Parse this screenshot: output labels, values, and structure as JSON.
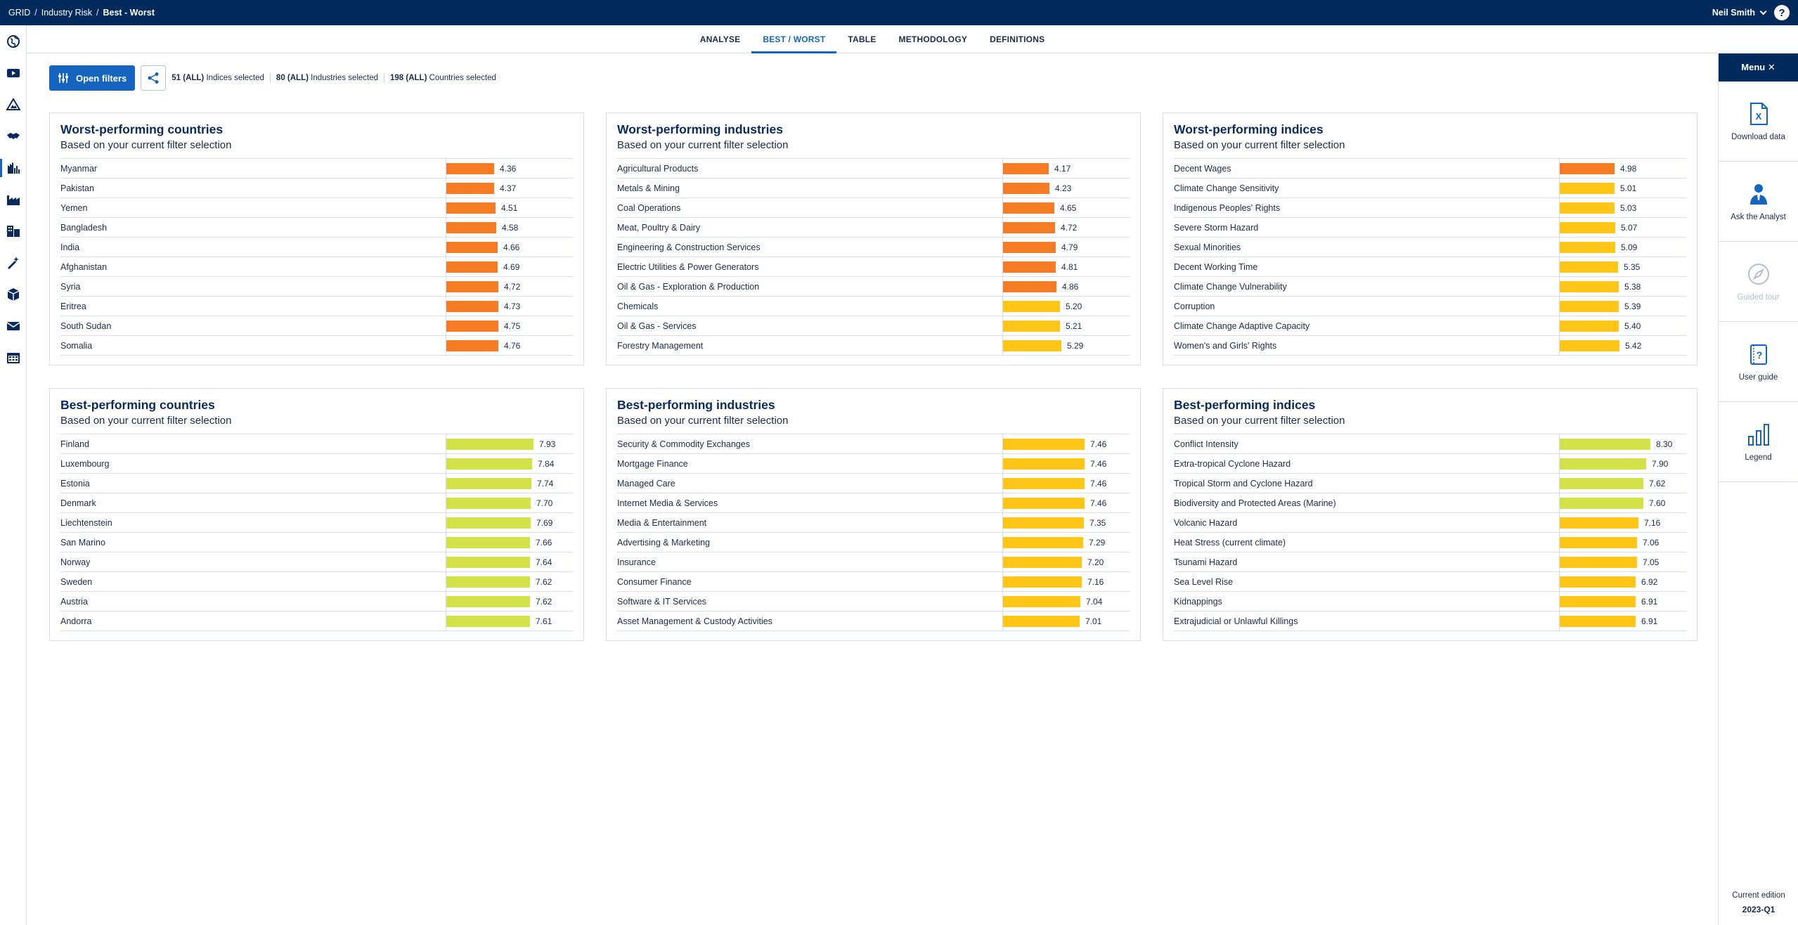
{
  "topbar": {
    "crumbs": [
      "GRID",
      "Industry Risk",
      "Best - Worst"
    ],
    "user": "Neil Smith",
    "help": "?"
  },
  "tabs": [
    "ANALYSE",
    "BEST / WORST",
    "TABLE",
    "METHODOLOGY",
    "DEFINITIONS"
  ],
  "active_tab": 1,
  "filters": {
    "open_label": "Open filters",
    "indices_count": "51 (ALL)",
    "indices_label": "Indices selected",
    "industries_count": "80 (ALL)",
    "industries_label": "Industries selected",
    "countries_count": "198 (ALL)",
    "countries_label": "Countries selected"
  },
  "right_panel": {
    "menu_label": "Menu ✕",
    "items": [
      "Download data",
      "Ask the Analyst",
      "Guided tour",
      "User guide",
      "Legend"
    ],
    "edition_label": "Current edition",
    "edition_value": "2023-Q1"
  },
  "colors": {
    "orange": "#f57c25",
    "amber": "#ffc617",
    "lime": "#d4e24a",
    "navy": "#002a5c",
    "blue": "#1565c0"
  },
  "scale_max": 10,
  "cards": [
    {
      "title": "Worst-performing countries",
      "subtitle": "Based on your current filter selection",
      "rows": [
        {
          "name": "Myanmar",
          "value": "4.36",
          "color": "orange"
        },
        {
          "name": "Pakistan",
          "value": "4.37",
          "color": "orange"
        },
        {
          "name": "Yemen",
          "value": "4.51",
          "color": "orange"
        },
        {
          "name": "Bangladesh",
          "value": "4.58",
          "color": "orange"
        },
        {
          "name": "India",
          "value": "4.66",
          "color": "orange"
        },
        {
          "name": "Afghanistan",
          "value": "4.69",
          "color": "orange"
        },
        {
          "name": "Syria",
          "value": "4.72",
          "color": "orange"
        },
        {
          "name": "Eritrea",
          "value": "4.73",
          "color": "orange"
        },
        {
          "name": "South Sudan",
          "value": "4.75",
          "color": "orange"
        },
        {
          "name": "Somalia",
          "value": "4.76",
          "color": "orange"
        }
      ]
    },
    {
      "title": "Worst-performing industries",
      "subtitle": "Based on your current filter selection",
      "rows": [
        {
          "name": "Agricultural Products",
          "value": "4.17",
          "color": "orange"
        },
        {
          "name": "Metals & Mining",
          "value": "4.23",
          "color": "orange"
        },
        {
          "name": "Coal Operations",
          "value": "4.65",
          "color": "orange"
        },
        {
          "name": "Meat, Poultry & Dairy",
          "value": "4.72",
          "color": "orange"
        },
        {
          "name": "Engineering & Construction Services",
          "value": "4.79",
          "color": "orange"
        },
        {
          "name": "Electric Utilities & Power Generators",
          "value": "4.81",
          "color": "orange"
        },
        {
          "name": "Oil & Gas - Exploration & Production",
          "value": "4.86",
          "color": "orange"
        },
        {
          "name": "Chemicals",
          "value": "5.20",
          "color": "amber"
        },
        {
          "name": "Oil & Gas - Services",
          "value": "5.21",
          "color": "amber"
        },
        {
          "name": "Forestry Management",
          "value": "5.29",
          "color": "amber"
        }
      ]
    },
    {
      "title": "Worst-performing indices",
      "subtitle": "Based on your current filter selection",
      "rows": [
        {
          "name": "Decent Wages",
          "value": "4.98",
          "color": "orange"
        },
        {
          "name": "Climate Change Sensitivity",
          "value": "5.01",
          "color": "amber"
        },
        {
          "name": "Indigenous Peoples' Rights",
          "value": "5.03",
          "color": "amber"
        },
        {
          "name": "Severe Storm Hazard",
          "value": "5.07",
          "color": "amber"
        },
        {
          "name": "Sexual Minorities",
          "value": "5.09",
          "color": "amber"
        },
        {
          "name": "Decent Working Time",
          "value": "5.35",
          "color": "amber"
        },
        {
          "name": "Climate Change Vulnerability",
          "value": "5.38",
          "color": "amber"
        },
        {
          "name": "Corruption",
          "value": "5.39",
          "color": "amber"
        },
        {
          "name": "Climate Change Adaptive Capacity",
          "value": "5.40",
          "color": "amber"
        },
        {
          "name": "Women's and Girls' Rights",
          "value": "5.42",
          "color": "amber"
        }
      ]
    },
    {
      "title": "Best-performing countries",
      "subtitle": "Based on your current filter selection",
      "rows": [
        {
          "name": "Finland",
          "value": "7.93",
          "color": "lime"
        },
        {
          "name": "Luxembourg",
          "value": "7.84",
          "color": "lime"
        },
        {
          "name": "Estonia",
          "value": "7.74",
          "color": "lime"
        },
        {
          "name": "Denmark",
          "value": "7.70",
          "color": "lime"
        },
        {
          "name": "Liechtenstein",
          "value": "7.69",
          "color": "lime"
        },
        {
          "name": "San Marino",
          "value": "7.66",
          "color": "lime"
        },
        {
          "name": "Norway",
          "value": "7.64",
          "color": "lime"
        },
        {
          "name": "Sweden",
          "value": "7.62",
          "color": "lime"
        },
        {
          "name": "Austria",
          "value": "7.62",
          "color": "lime"
        },
        {
          "name": "Andorra",
          "value": "7.61",
          "color": "lime"
        }
      ]
    },
    {
      "title": "Best-performing industries",
      "subtitle": "Based on your current filter selection",
      "rows": [
        {
          "name": "Security & Commodity Exchanges",
          "value": "7.46",
          "color": "amber"
        },
        {
          "name": "Mortgage Finance",
          "value": "7.46",
          "color": "amber"
        },
        {
          "name": "Managed Care",
          "value": "7.46",
          "color": "amber"
        },
        {
          "name": "Internet Media & Services",
          "value": "7.46",
          "color": "amber"
        },
        {
          "name": "Media & Entertainment",
          "value": "7.35",
          "color": "amber"
        },
        {
          "name": "Advertising & Marketing",
          "value": "7.29",
          "color": "amber"
        },
        {
          "name": "Insurance",
          "value": "7.20",
          "color": "amber"
        },
        {
          "name": "Consumer Finance",
          "value": "7.16",
          "color": "amber"
        },
        {
          "name": "Software & IT Services",
          "value": "7.04",
          "color": "amber"
        },
        {
          "name": "Asset Management & Custody Activities",
          "value": "7.01",
          "color": "amber"
        }
      ]
    },
    {
      "title": "Best-performing indices",
      "subtitle": "Based on your current filter selection",
      "rows": [
        {
          "name": "Conflict Intensity",
          "value": "8.30",
          "color": "lime"
        },
        {
          "name": "Extra-tropical Cyclone Hazard",
          "value": "7.90",
          "color": "lime"
        },
        {
          "name": "Tropical Storm and Cyclone Hazard",
          "value": "7.62",
          "color": "lime"
        },
        {
          "name": "Biodiversity and Protected Areas (Marine)",
          "value": "7.60",
          "color": "lime"
        },
        {
          "name": "Volcanic Hazard",
          "value": "7.16",
          "color": "amber"
        },
        {
          "name": "Heat Stress (current climate)",
          "value": "7.06",
          "color": "amber"
        },
        {
          "name": "Tsunami Hazard",
          "value": "7.05",
          "color": "amber"
        },
        {
          "name": "Sea Level Rise",
          "value": "6.92",
          "color": "amber"
        },
        {
          "name": "Kidnappings",
          "value": "6.91",
          "color": "amber"
        },
        {
          "name": "Extrajudicial or Unlawful Killings",
          "value": "6.91",
          "color": "amber"
        }
      ]
    }
  ]
}
